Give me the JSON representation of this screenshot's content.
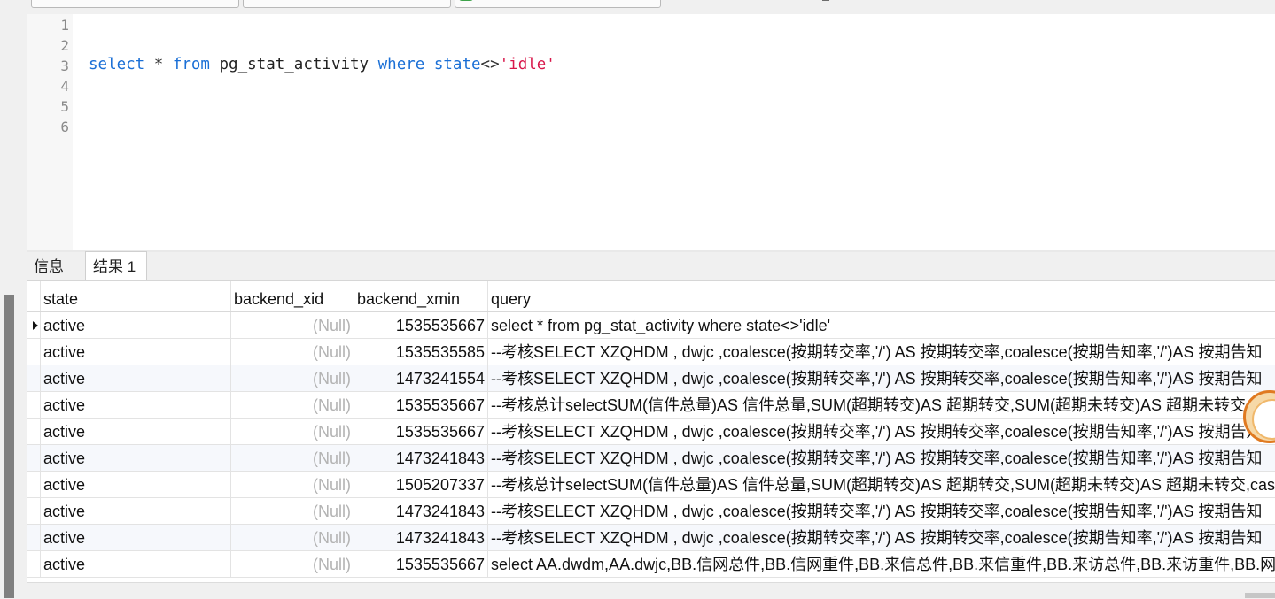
{
  "editor": {
    "line_numbers": [
      "1",
      "2",
      "3",
      "4",
      "5",
      "6"
    ],
    "sql": {
      "kw_select": "select",
      "star": " * ",
      "kw_from": "from",
      "table": " pg_stat_activity ",
      "kw_where": "where",
      "col": " state",
      "op": "<>",
      "literal": "'idle'"
    }
  },
  "result_tabs": [
    {
      "label": "信息",
      "active": false
    },
    {
      "label": "结果 1",
      "active": true
    }
  ],
  "grid": {
    "columns": [
      "state",
      "backend_xid",
      "backend_xmin",
      "query"
    ],
    "rows": [
      {
        "state": "active",
        "backend_xid": "(Null)",
        "backend_xmin": "1535535667",
        "query": "select * from pg_stat_activity where state<>'idle'"
      },
      {
        "state": "active",
        "backend_xid": "(Null)",
        "backend_xmin": "1535535585",
        "query": "--考核SELECT XZQHDM , dwjc ,coalesce(按期转交率,'/') AS 按期转交率,coalesce(按期告知率,'/')AS 按期告知"
      },
      {
        "state": "active",
        "backend_xid": "(Null)",
        "backend_xmin": "1473241554",
        "query": "--考核SELECT XZQHDM , dwjc ,coalesce(按期转交率,'/') AS 按期转交率,coalesce(按期告知率,'/')AS 按期告知"
      },
      {
        "state": "active",
        "backend_xid": "(Null)",
        "backend_xmin": "1535535667",
        "query": "--考核总计selectSUM(信件总量)AS 信件总量,SUM(超期转交)AS 超期转交,SUM(超期未转交)AS 超期未转交"
      },
      {
        "state": "active",
        "backend_xid": "(Null)",
        "backend_xmin": "1535535667",
        "query": "--考核SELECT XZQHDM , dwjc ,coalesce(按期转交率,'/') AS 按期转交率,coalesce(按期告知率,'/')AS 按期告知"
      },
      {
        "state": "active",
        "backend_xid": "(Null)",
        "backend_xmin": "1473241843",
        "query": "--考核SELECT XZQHDM , dwjc ,coalesce(按期转交率,'/') AS 按期转交率,coalesce(按期告知率,'/')AS 按期告知"
      },
      {
        "state": "active",
        "backend_xid": "(Null)",
        "backend_xmin": "1505207337",
        "query": "--考核总计selectSUM(信件总量)AS 信件总量,SUM(超期转交)AS 超期转交,SUM(超期未转交)AS 超期未转交,cas"
      },
      {
        "state": "active",
        "backend_xid": "(Null)",
        "backend_xmin": "1473241843",
        "query": "--考核SELECT XZQHDM , dwjc ,coalesce(按期转交率,'/') AS 按期转交率,coalesce(按期告知率,'/')AS 按期告知"
      },
      {
        "state": "active",
        "backend_xid": "(Null)",
        "backend_xmin": "1473241843",
        "query": "--考核SELECT XZQHDM , dwjc ,coalesce(按期转交率,'/') AS 按期转交率,coalesce(按期告知率,'/')AS 按期告知"
      },
      {
        "state": "active",
        "backend_xid": "(Null)",
        "backend_xmin": "1535535667",
        "query": "select AA.dwdm,AA.dwjc,BB.信网总件,BB.信网重件,BB.来信总件,BB.来信重件,BB.来访总件,BB.来访重件,BB.网上"
      }
    ]
  },
  "icons": {
    "tab1": "database-icon",
    "tab2": "connection-icon",
    "tab3": "table-icon",
    "row_selected": "row-pointer-icon",
    "floating": "assistant-badge-icon"
  },
  "colors": {
    "keyword": "#1a6fd6",
    "string": "#d8174a",
    "null": "#b3b3b3",
    "tab1_icon": "#3b7be0",
    "tab2_icon": "#2f9e3e",
    "tab3_icon": "#3ea34a"
  }
}
